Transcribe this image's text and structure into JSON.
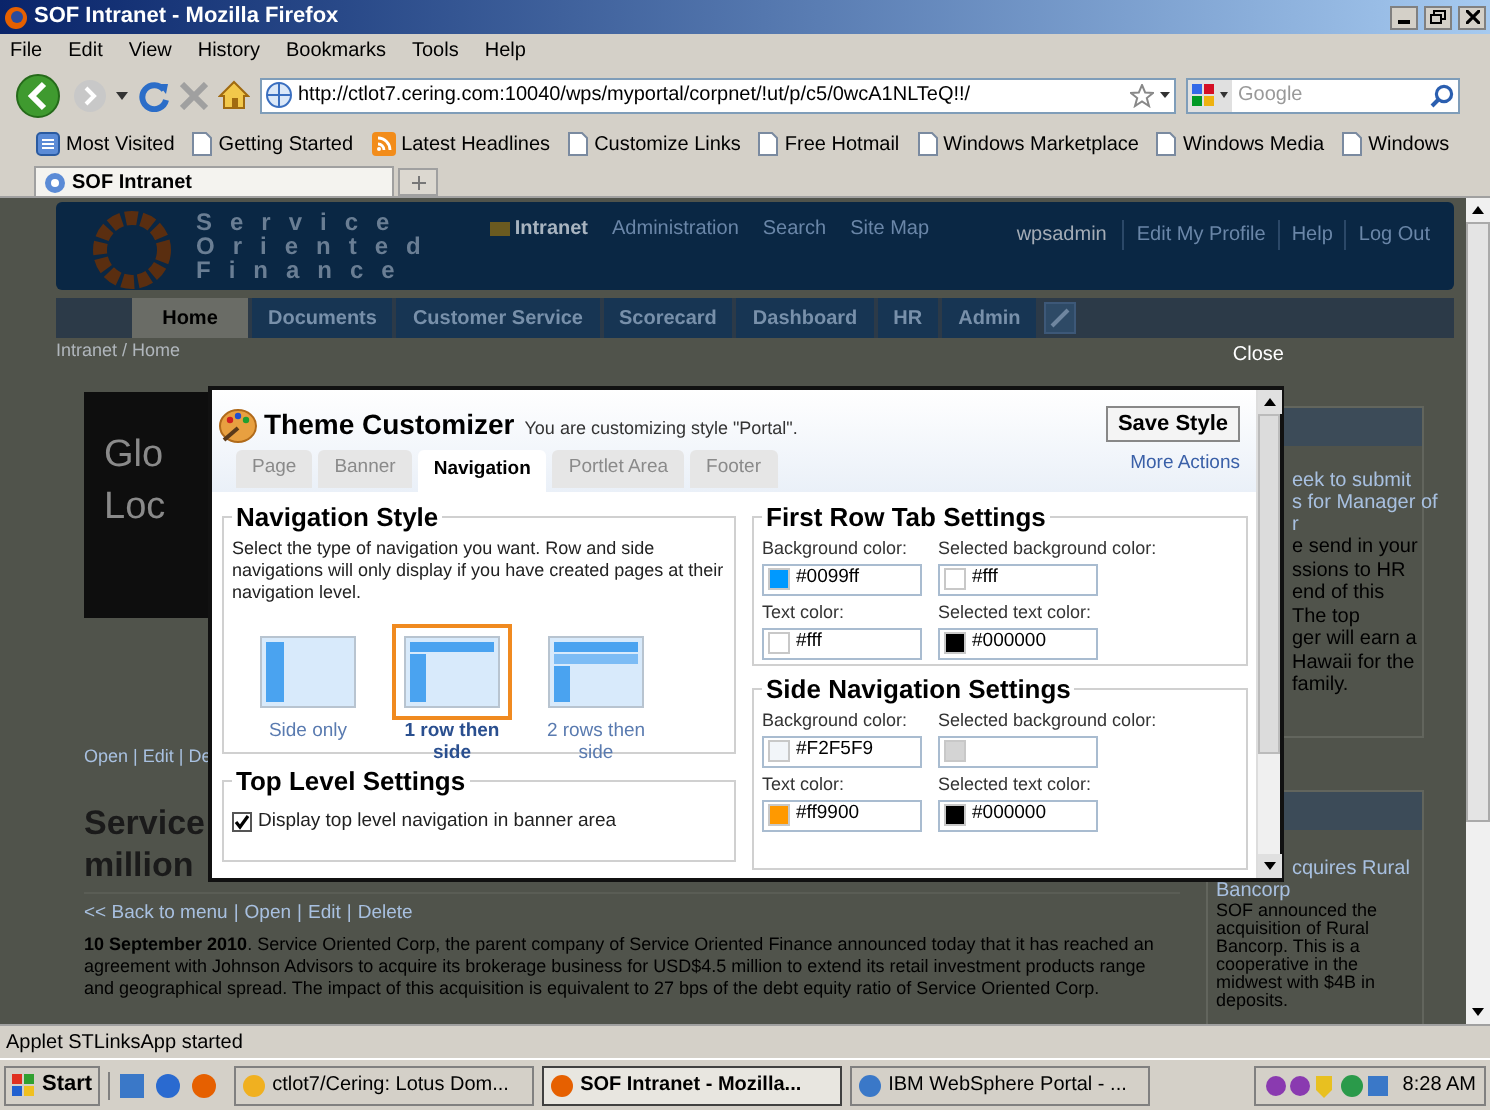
{
  "window": {
    "title": "SOF Intranet - Mozilla Firefox"
  },
  "menu": [
    "File",
    "Edit",
    "View",
    "History",
    "Bookmarks",
    "Tools",
    "Help"
  ],
  "address": {
    "value": "http://ctlot7.cering.com:10040/wps/myportal/corpnet/!ut/p/c5/0wcA1NLTeQ!!/"
  },
  "search": {
    "placeholder": "Google"
  },
  "bookmarks": [
    {
      "label": "Most Visited",
      "kind": "smart"
    },
    {
      "label": "Getting Started",
      "kind": "page"
    },
    {
      "label": "Latest Headlines",
      "kind": "feed"
    },
    {
      "label": "Customize Links",
      "kind": "page"
    },
    {
      "label": "Free Hotmail",
      "kind": "page"
    },
    {
      "label": "Windows Marketplace",
      "kind": "page"
    },
    {
      "label": "Windows Media",
      "kind": "page"
    },
    {
      "label": "Windows",
      "kind": "page"
    }
  ],
  "tabs": [
    {
      "label": "SOF Intranet",
      "selected": true
    }
  ],
  "portal": {
    "logo": [
      "Service",
      "Oriented",
      "Finance"
    ],
    "top_links": [
      {
        "label": "Intranet",
        "selected": true
      },
      {
        "label": "Administration",
        "selected": false
      },
      {
        "label": "Search",
        "selected": false
      },
      {
        "label": "Site Map",
        "selected": false
      }
    ],
    "user": "wpsadmin",
    "user_links": [
      "Edit My Profile",
      "Help",
      "Log Out"
    ],
    "nav_tabs": [
      {
        "label": "Home",
        "selected": true
      },
      {
        "label": "Documents",
        "selected": false
      },
      {
        "label": "Customer Service",
        "selected": false
      },
      {
        "label": "Scorecard",
        "selected": false
      },
      {
        "label": "Dashboard",
        "selected": false
      },
      {
        "label": "HR",
        "selected": false
      },
      {
        "label": "Admin",
        "selected": false
      }
    ],
    "close": "Close",
    "breadcrumb": [
      "Intranet",
      "Home"
    ],
    "breadcrumb_separator": "/",
    "link_separator": "|",
    "feature_lines": [
      "Glo",
      "Loc"
    ],
    "feature_links": "Open | Edit | De",
    "article": {
      "title_lines": [
        "Service",
        "million"
      ],
      "links": [
        "<< Back to menu",
        "Open",
        "Edit",
        "Delete"
      ],
      "body": "**10 September 2010**. Service Oriented Corp, the parent company of Service Oriented Finance announced today that it has reached an agreement with Johnson Advisors to acquire its brokerage business for USD$4.5 million to extend its retail investment products range and geographical spread. The impact of this acquisition is equivalent to 27 bps of the debt equity ratio of Service Oriented Corp."
    },
    "sidebar": [
      {
        "title_lines": [
          "eek to submit",
          "s for Manager of",
          "r"
        ],
        "body_lines": [
          "e send in your",
          "ssions to HR",
          "end of this",
          "The top",
          "ger will earn a",
          "Hawaii for the",
          "family."
        ]
      },
      {
        "title_lines": [
          "cquires Rural",
          "Bancorp"
        ],
        "body_lines": [
          "SOF announced the",
          "acquisition of Rural",
          "Bancorp. This is a",
          "cooperative in the",
          "midwest with $4B in",
          "deposits."
        ]
      }
    ]
  },
  "dialog": {
    "title": "Theme Customizer",
    "subtitle": "You are customizing style \"Portal\".",
    "save_button": "Save Style",
    "more_actions": "More Actions",
    "tabs": [
      {
        "label": "Page",
        "selected": false
      },
      {
        "label": "Banner",
        "selected": false
      },
      {
        "label": "Navigation",
        "selected": true
      },
      {
        "label": "Portlet Area",
        "selected": false
      },
      {
        "label": "Footer",
        "selected": false
      }
    ],
    "navigation_style": {
      "heading": "Navigation Style",
      "description": "Select the type of navigation you want. Row and side navigations will only display if you have created pages at their navigation level.",
      "options": [
        {
          "label": "Side only",
          "kind": "side",
          "selected": false
        },
        {
          "label": "1 row then side",
          "kind": "row-side",
          "selected": true
        },
        {
          "label": "2 rows then side",
          "kind": "rows-side",
          "selected": false
        }
      ]
    },
    "top_level": {
      "heading": "Top Level Settings",
      "checkbox": {
        "label": "Display top level navigation in banner area",
        "checked": true
      }
    },
    "color_groups": [
      {
        "heading": "First Row Tab Settings",
        "fields": [
          {
            "label": "Background color:",
            "color": "#0099ff",
            "value": "#0099ff"
          },
          {
            "label": "Selected background color:",
            "color": "#ffffff",
            "value": "#fff"
          },
          {
            "label": "Text color:",
            "color": "#ffffff",
            "value": "#fff"
          },
          {
            "label": "Selected text color:",
            "color": "#000000",
            "value": "#000000"
          }
        ]
      },
      {
        "heading": "Side Navigation Settings",
        "fields": [
          {
            "label": "Background color:",
            "color": "#f2f5f9",
            "value": "#F2F5F9"
          },
          {
            "label": "Selected background color:",
            "color": "#d4d4d4"
          },
          {
            "label": "Text color:",
            "color": "#ff9900",
            "value": "#ff9900"
          },
          {
            "label": "Selected text color:",
            "color": "#000000",
            "value": "#000000"
          }
        ]
      }
    ]
  },
  "status_bar": "Applet STLinksApp started",
  "taskbar": {
    "start": "Start",
    "tasks": [
      {
        "label": "ctlot7/Cering: Lotus Dom...",
        "selected": false
      },
      {
        "label": "SOF Intranet - Mozilla...",
        "selected": true
      },
      {
        "label": "IBM WebSphere Portal - ...",
        "selected": false
      }
    ],
    "clock": "8:28 AM"
  }
}
